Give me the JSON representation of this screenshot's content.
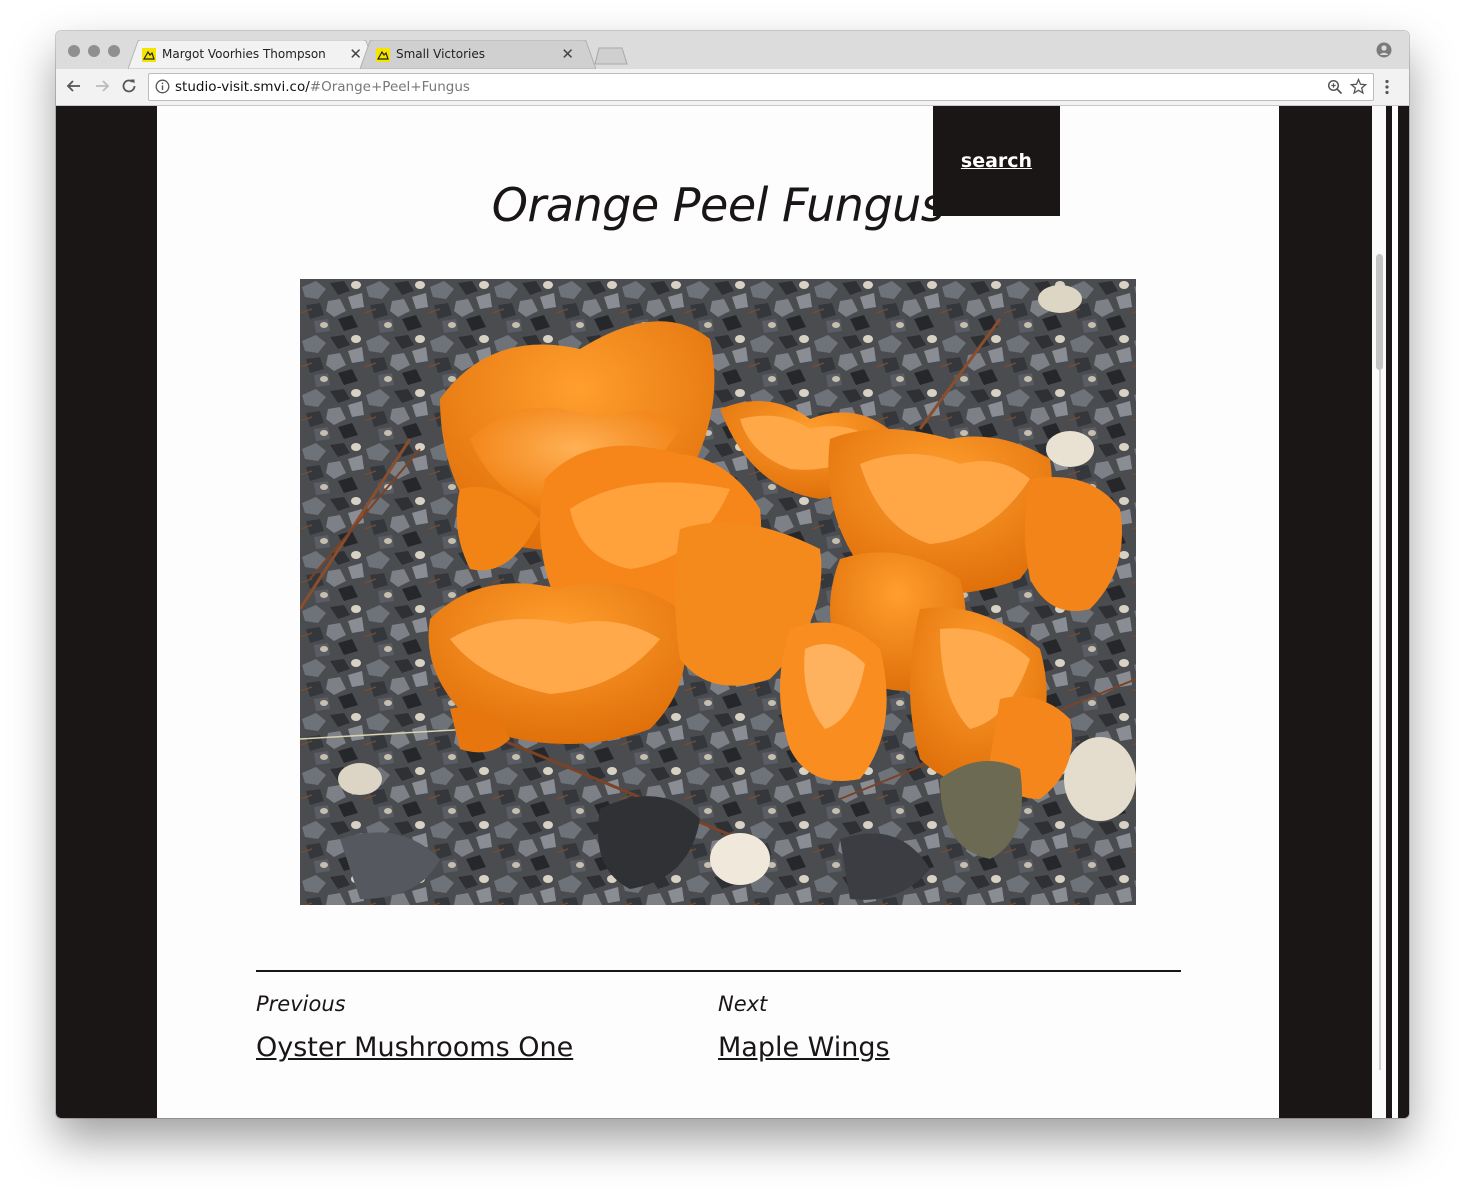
{
  "browser": {
    "tabs": [
      {
        "title": "Margot Voorhies Thompson",
        "active": true
      },
      {
        "title": "Small Victories",
        "active": false
      }
    ],
    "url_host": "studio-visit.smvi.co/",
    "url_path": "#Orange+Peel+Fungus"
  },
  "page": {
    "search_label": "search",
    "title": "Orange Peel Fungus",
    "photo_alt": "Orange Peel Fungus",
    "previous_label": "Previous",
    "previous_link": "Oyster Mushrooms One",
    "next_label": "Next",
    "next_link": "Maple Wings"
  },
  "colors": {
    "page_dark": "#1a1616",
    "fungus_orange": "#f5891a",
    "favicon_yellow": "#f4e400"
  }
}
